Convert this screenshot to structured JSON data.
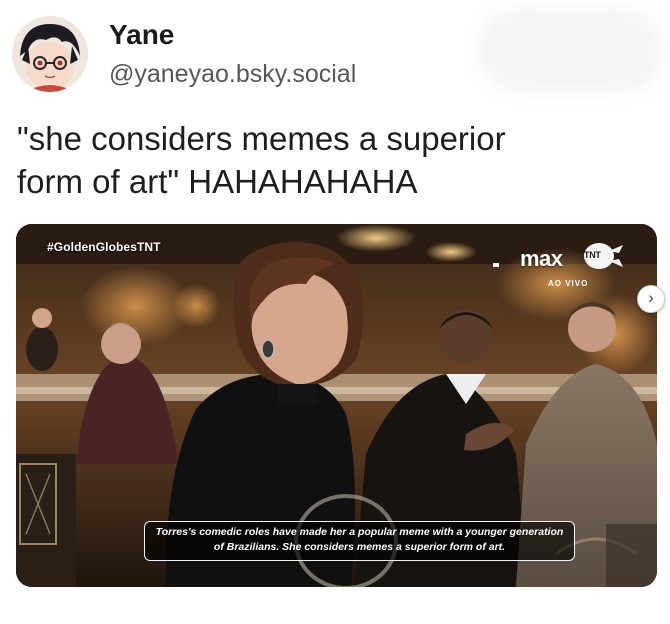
{
  "author": {
    "name": "Yane",
    "handle": "@yaneyao.bsky.social"
  },
  "post": {
    "text": "\"she considers memes a superior\nform of art\" HAHAHAHAHA"
  },
  "media": {
    "hashtag": "#GoldenGlobesTNT",
    "brand_max": "max",
    "brand_tnt": "TNT",
    "live_label": "AO VIVO",
    "caption": "Torres's comedic roles have made her a popular meme with a younger generation of Brazilians. She considers memes a superior form of art."
  },
  "controls": {
    "next_glyph": "›"
  },
  "icons": {
    "avatar": "avatar-icon",
    "next": "chevron-right-icon",
    "tnt": "tnt-logo-icon"
  }
}
